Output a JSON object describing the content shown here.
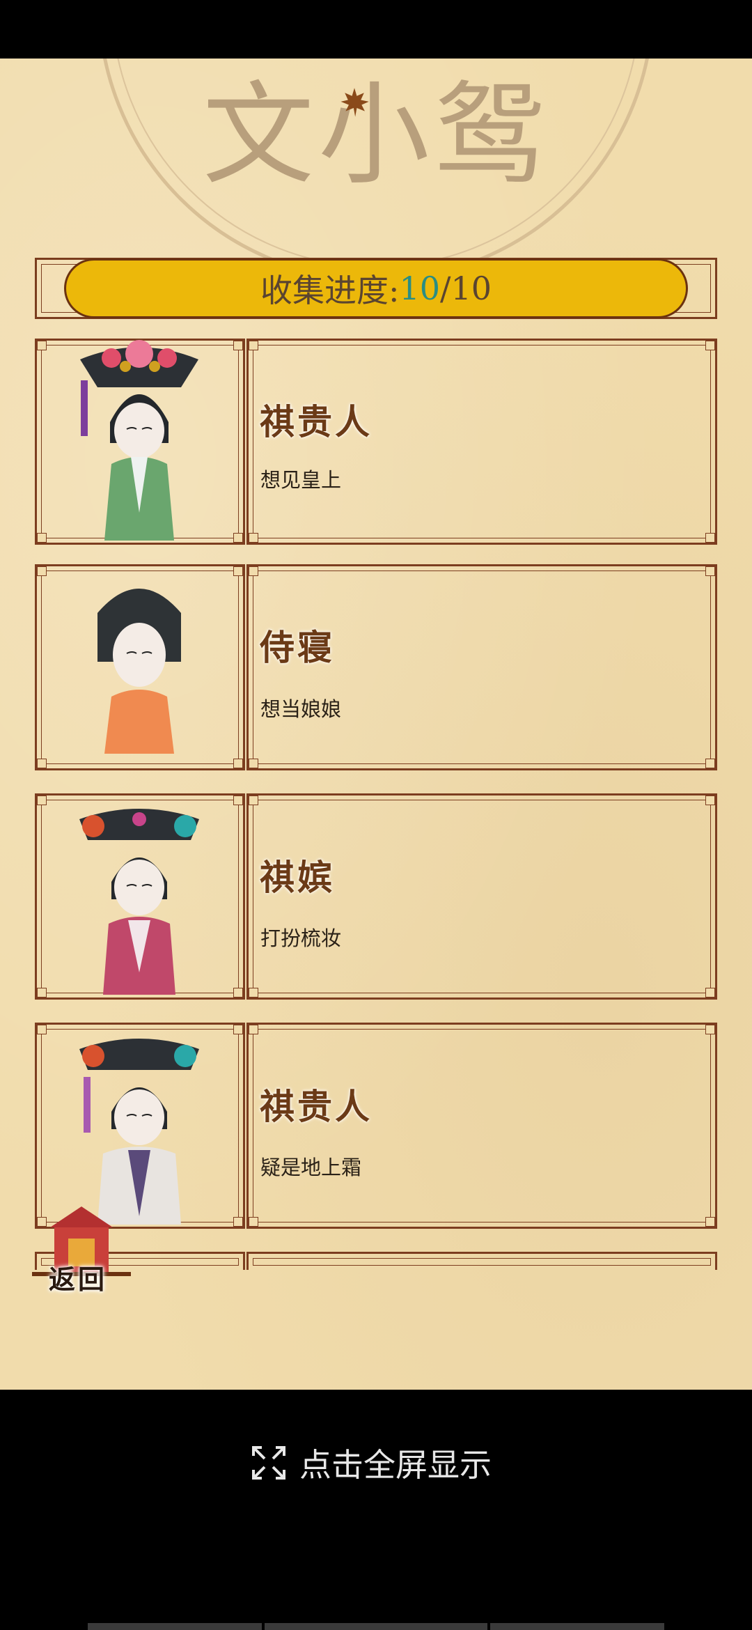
{
  "logo": {
    "text": "文小鸳"
  },
  "progress": {
    "label": "收集进度:",
    "current": "10",
    "total": "/10"
  },
  "collection": [
    {
      "name": "祺贵人",
      "desc": "想见皇上"
    },
    {
      "name": "侍寝",
      "desc": "想当娘娘"
    },
    {
      "name": "祺嫔",
      "desc": "打扮梳妆"
    },
    {
      "name": "祺贵人",
      "desc": "疑是地上霜"
    }
  ],
  "back_button": {
    "label": "返回"
  },
  "fullscreen": {
    "label": "点击全屏显示",
    "icon": "expand-icon"
  },
  "colors": {
    "parchment": "#f1dcac",
    "gold": "#ecb80a",
    "frame": "#7c3d1f",
    "teal": "#2a8d84"
  }
}
